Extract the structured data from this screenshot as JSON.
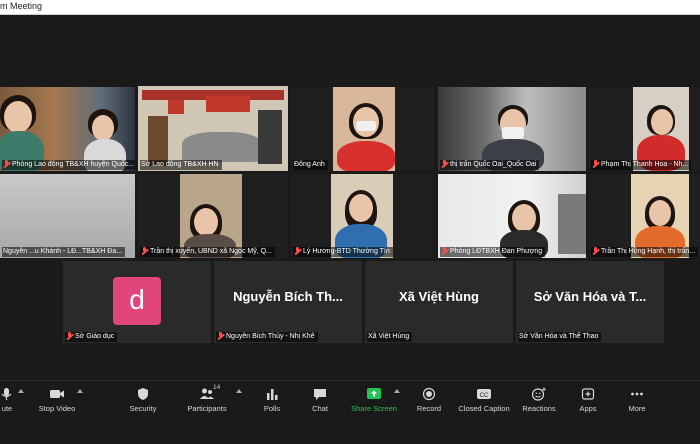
{
  "window": {
    "title": "m Meeting"
  },
  "tiles": [
    {
      "name": "tile-1",
      "label": "Phòng Lao động TB&XH huyện Quốc...",
      "muted": true
    },
    {
      "name": "tile-2",
      "label": "Sở Lao động TB&XH HN",
      "muted": false,
      "active": true
    },
    {
      "name": "tile-3",
      "label": "Đông Anh",
      "muted": false
    },
    {
      "name": "tile-4",
      "label": "thị trấn Quốc Oai_Quốc Oai",
      "muted": true
    },
    {
      "name": "tile-5",
      "label": "Phạm Thị Thanh Hoa - Nh...",
      "muted": true
    },
    {
      "name": "tile-6",
      "label": "Nguyễn ...u Khánh - LĐ...TB&XH Đa...",
      "muted": false
    },
    {
      "name": "tile-7",
      "label": "Trần thị xuyến, UBND xã Ngọc Mỹ, Q...",
      "muted": true
    },
    {
      "name": "tile-8",
      "label": "Lý Hương-BTD Thường Tín",
      "muted": true
    },
    {
      "name": "tile-9",
      "label": "Phòng LĐTBXH Đan Phượng",
      "muted": true
    },
    {
      "name": "tile-10",
      "label": "Trần Thị Hồng Hạnh, thị trấn...",
      "muted": true
    }
  ],
  "name_tiles": [
    {
      "name": "tile-so-giao-duc",
      "avatar_letter": "d",
      "label": "Sở Giáo dục",
      "muted": true
    },
    {
      "name": "tile-nguyen-bich-thuy",
      "display_name": "Nguyễn Bích Th...",
      "label": "Nguyễn Bích Thủy - Nhị Khê",
      "muted": true
    },
    {
      "name": "tile-xa-viet-hung",
      "display_name": "Xã Việt Hùng",
      "label": "Xã Việt Hùng",
      "muted": false
    },
    {
      "name": "tile-so-van-hoa",
      "display_name": "Sở Văn Hóa và T...",
      "label": "Sở Văn Hóa và Thể Thao",
      "muted": false
    }
  ],
  "toolbar": {
    "mute": "ute",
    "stop_video": "Stop Video",
    "security": "Security",
    "participants": "Participants",
    "participants_count": "14",
    "polls": "Polls",
    "chat": "Chat",
    "share_screen": "Share Screen",
    "record": "Record",
    "closed_caption": "Closed Caption",
    "reactions": "Reactions",
    "apps": "Apps",
    "more": "More"
  },
  "colors": {
    "active_border": "#c8e040",
    "share_green": "#23c552",
    "avatar_pink": "#e0467c"
  }
}
